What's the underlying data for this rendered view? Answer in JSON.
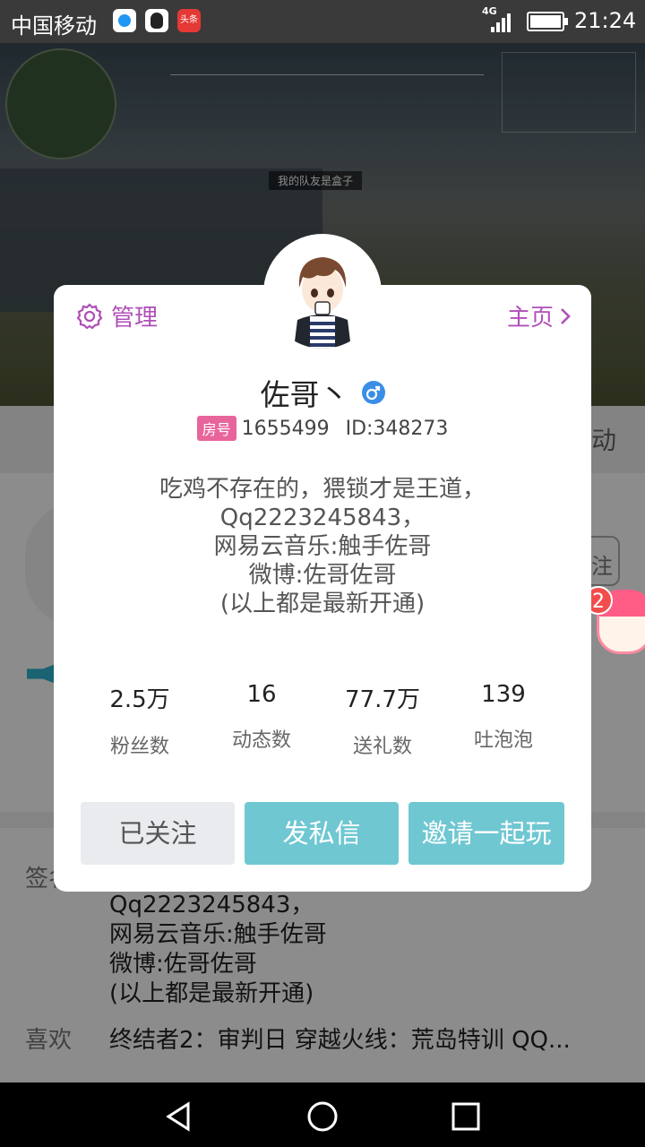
{
  "status_bar": {
    "carrier": "中国移动",
    "network": "4G",
    "time": "21:24",
    "notification_icons": [
      "browser-icon",
      "qq-icon",
      "toutiao-icon"
    ],
    "app3_text": "头条"
  },
  "background_page": {
    "teammate_banner": "我的队友是盒子",
    "tab_right_fragment": "动",
    "follow_fragment": "注",
    "signature_label": "签名",
    "signature_visible": "Qq2223245843，\n网易云音乐:触手佐哥\n微博:佐哥佐哥\n(以上都是最新开通)",
    "likes_label": "喜欢",
    "likes_text": "终结者2：审判日  穿越火线：荒岛特训  QQ..."
  },
  "floating_widget": {
    "badge_count": "2"
  },
  "profile_card": {
    "manage_label": "管理",
    "homepage_label": "主页",
    "nickname": "佐哥丶",
    "gender_icon": "male-icon",
    "room_badge": "房号",
    "room_number": "1655499",
    "user_id": "ID:348273",
    "bio": "吃鸡不存在的，猥锁才是王道，\nQq2223245843，\n网易云音乐:触手佐哥\n微博:佐哥佐哥\n(以上都是最新开通)",
    "stats": [
      {
        "value": "2.5万",
        "label": "粉丝数"
      },
      {
        "value": "16",
        "label": "动态数"
      },
      {
        "value": "77.7万",
        "label": "送礼数"
      },
      {
        "value": "139",
        "label": "吐泡泡"
      }
    ],
    "buttons": {
      "following": "已关注",
      "message": "发私信",
      "invite": "邀请一起玩"
    }
  },
  "colors": {
    "accent_purple": "#b04fb8",
    "action_teal": "#6fc7d2",
    "room_badge_pink": "#e8659b"
  }
}
